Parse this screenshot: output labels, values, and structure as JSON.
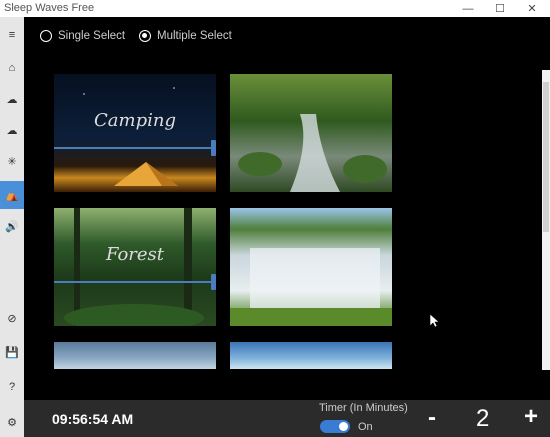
{
  "window": {
    "title": "Sleep Waves Free",
    "controls": [
      "—",
      "☐",
      "✕"
    ]
  },
  "sidebar": {
    "items": [
      {
        "name": "menu-icon",
        "glyph": "≡"
      },
      {
        "name": "home-icon",
        "glyph": "⌂"
      },
      {
        "name": "rain-cloud-icon",
        "glyph": "☁"
      },
      {
        "name": "thunder-cloud-icon",
        "glyph": "☁"
      },
      {
        "name": "snowflake-icon",
        "glyph": "✳"
      },
      {
        "name": "tent-icon",
        "glyph": "⛺"
      },
      {
        "name": "speaker-icon",
        "glyph": "🔊"
      },
      {
        "name": "block-icon",
        "glyph": "⊘"
      },
      {
        "name": "save-icon",
        "glyph": "💾"
      },
      {
        "name": "help-icon",
        "glyph": "?"
      },
      {
        "name": "settings-icon",
        "glyph": "⚙"
      }
    ]
  },
  "selection": {
    "single_label": "Single Select",
    "multiple_label": "Multiple Select",
    "selected": "multiple"
  },
  "tiles": [
    {
      "label": "Camping",
      "selected": true
    },
    {
      "label": "",
      "selected": false
    },
    {
      "label": "Forest",
      "selected": true
    },
    {
      "label": "",
      "selected": false
    },
    {
      "label": "",
      "selected": false
    },
    {
      "label": "",
      "selected": false
    }
  ],
  "bottom": {
    "clock": "09:56:54 AM",
    "timer_label": "Timer (In Minutes)",
    "toggle_state": "On",
    "minus": "-",
    "value": "2",
    "plus": "+"
  },
  "colors": {
    "accent": "#4a90d9",
    "background": "#000000",
    "bottom_bar": "#2b2b2b"
  }
}
